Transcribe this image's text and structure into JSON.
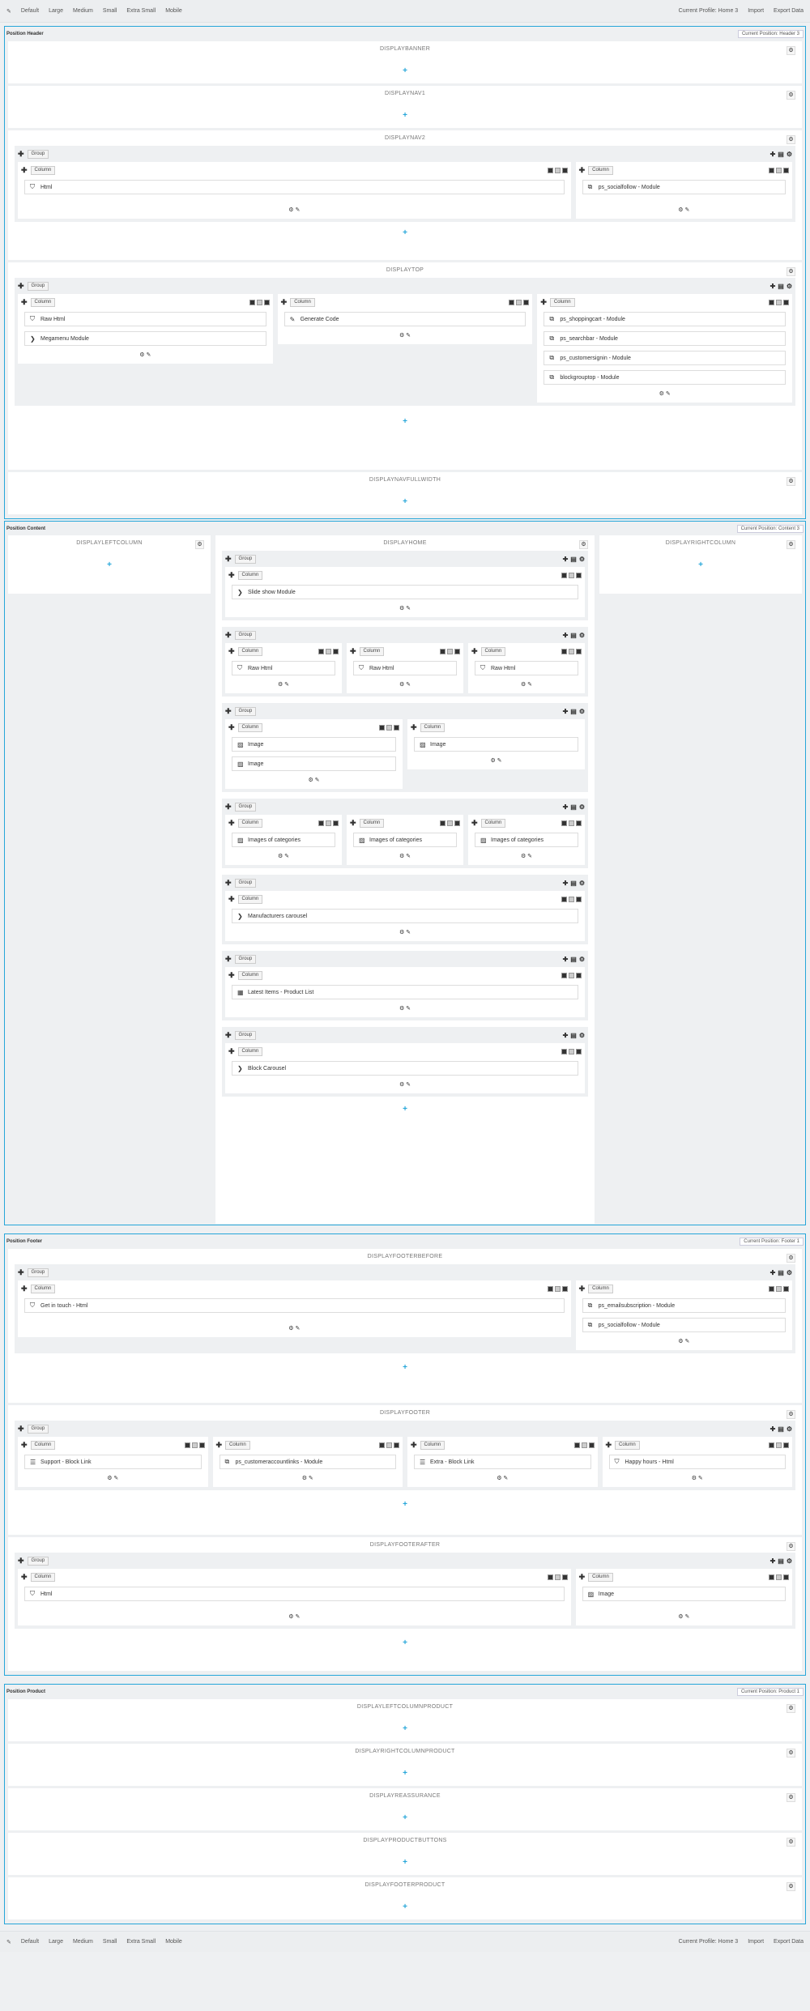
{
  "devices": [
    "Default",
    "Large",
    "Medium",
    "Small",
    "Extra Small",
    "Mobile"
  ],
  "actions": {
    "profile": "Current Profile: Home 3",
    "import": "Import",
    "export": "Export Data"
  },
  "header": {
    "title": "Position Header",
    "profile": "Current Position: Header 3"
  },
  "content": {
    "title": "Position Content",
    "profile": "Current Position: Content 3"
  },
  "footer": {
    "title": "Position Footer",
    "profile": "Current Position: Footer 1"
  },
  "product": {
    "title": "Position Product",
    "profile": "Current Position: Product 1"
  },
  "labels": {
    "group": "Group",
    "column": "Column"
  },
  "hooks": {
    "banner": "DISPLAYBANNER",
    "nav1": "DISPLAYNAV1",
    "nav2": "DISPLAYNAV2",
    "top": "DISPLAYTOP",
    "navfull": "DISPLAYNAVFULLWIDTH",
    "left": "DISPLAYLEFTCOLUMN",
    "home": "DISPLAYHOME",
    "right": "DISPLAYRIGHTCOLUMN",
    "fbefore": "DISPLAYFOOTERBEFORE",
    "footer": "DISPLAYFOOTER",
    "fafter": "DISPLAYFOOTERAFTER",
    "p1": "DISPLAYLEFTCOLUMNPRODUCT",
    "p2": "DISPLAYRIGHTCOLUMNPRODUCT",
    "p3": "DISPLAYREASSURANCE",
    "p4": "DISPLAYPRODUCTBUTTONS",
    "p5": "DISPLAYFOOTERPRODUCT"
  },
  "modules": {
    "html": "Html",
    "social": "ps_socialfollow - Module",
    "rawhtml": "Raw Html",
    "megamenu": "Megamenu Module",
    "gencode": "Generate Code",
    "cart": "ps_shoppingcart - Module",
    "search": "ps_searchbar - Module",
    "signin": "ps_customersignin - Module",
    "grouptop": "blockgrouptop - Module",
    "slideshow": "Slide show Module",
    "image": "Image",
    "imgcat": "Images of categories",
    "manu": "Manufacturers carousel",
    "latest": "Latest Items - Product List",
    "blockcar": "Block Carousel",
    "getin": "Get in touch - Html",
    "email": "ps_emailsubscription - Module",
    "support": "Support - Block Link",
    "account": "ps_customeraccountlinks - Module",
    "extra": "Extra - Block Link",
    "happy": "Happy hours - Html"
  }
}
